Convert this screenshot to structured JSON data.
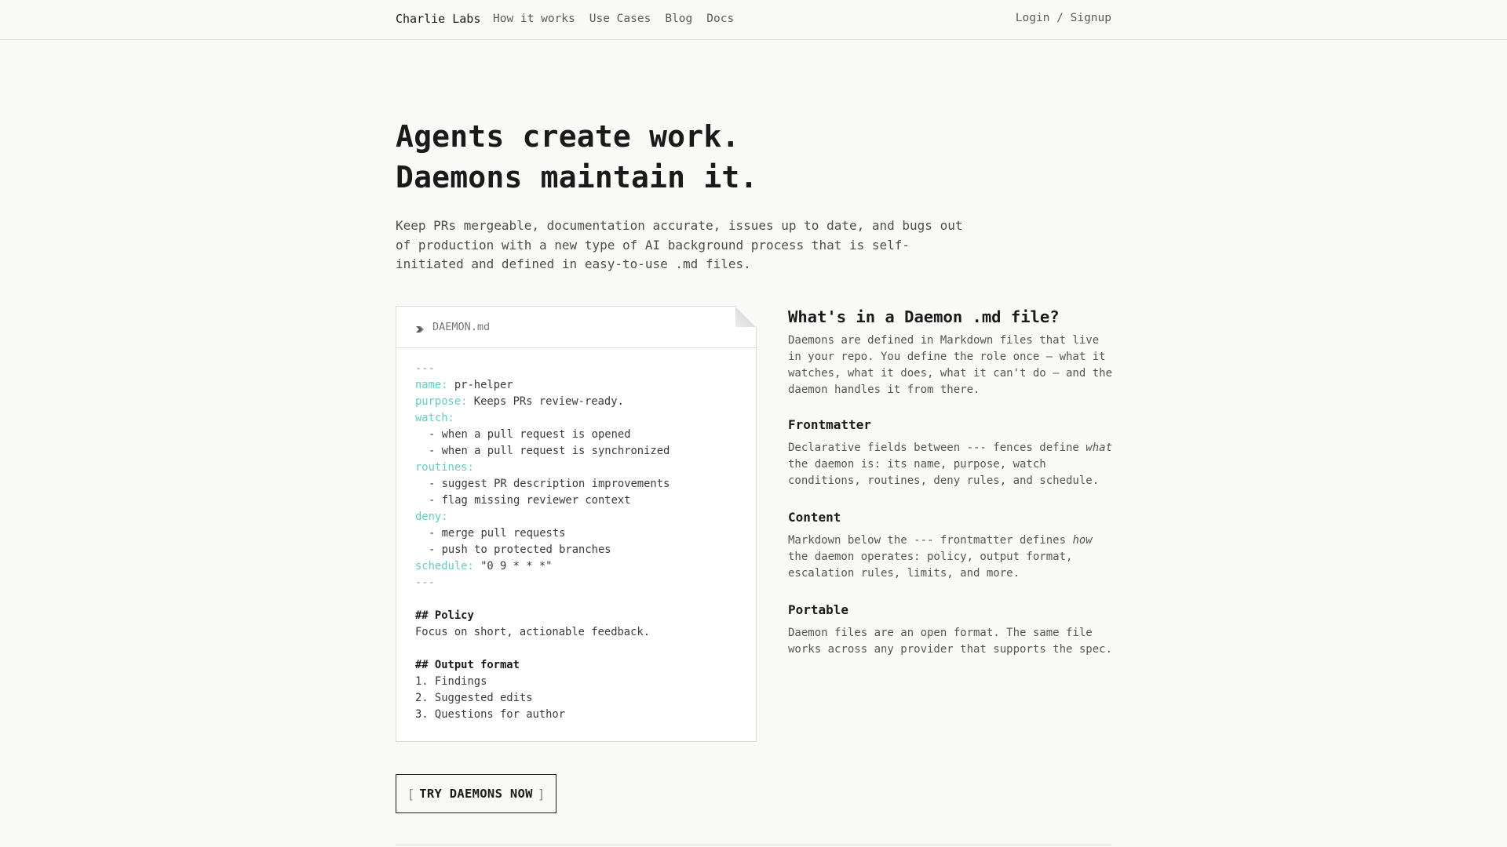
{
  "nav": {
    "brand": "Charlie Labs",
    "links": [
      "How it works",
      "Use Cases",
      "Blog",
      "Docs"
    ],
    "auth": "Login / Signup"
  },
  "hero": {
    "line1": "Agents create work.",
    "line2": "Daemons maintain it.",
    "subtitle": "Keep PRs mergeable, documentation accurate, issues up to date, and bugs out of production with a new type of AI background process that is self-initiated and defined in easy-to-use .md files."
  },
  "file": {
    "icon": "daemon-icon",
    "name": "DAEMON.md",
    "code": {
      "fence": "---",
      "name_key": "name:",
      "name_val": "pr-helper",
      "purpose_key": "purpose:",
      "purpose_val": "Keeps PRs review-ready.",
      "watch_key": "watch:",
      "watch": [
        "- when a pull request is opened",
        "- when a pull request is synchronized"
      ],
      "routines_key": "routines:",
      "routines": [
        "- suggest PR description improvements",
        "- flag missing reviewer context"
      ],
      "deny_key": "deny:",
      "deny": [
        "- merge pull requests",
        "- push to protected branches"
      ],
      "schedule_key": "schedule:",
      "schedule_val": "\"0 9 * * *\"",
      "policy_head": "## Policy",
      "policy_text": "Focus on short, actionable feedback.",
      "output_head": "## Output format",
      "output": [
        "1. Findings",
        "2. Suggested edits",
        "3. Questions for author"
      ]
    }
  },
  "side": {
    "title": "What's in a Daemon .md file?",
    "intro": "Daemons are defined in Markdown files that live in your repo. You define the role once — what it watches, what it does, what it can't do — and the daemon handles it from there.",
    "sections": {
      "frontmatter": {
        "title": "Frontmatter",
        "text_before": "Declarative fields between --- fences define ",
        "emph": "what",
        "text_after": " the daemon is: its name, purpose, watch conditions, routines, deny rules, and schedule."
      },
      "content": {
        "title": "Content",
        "text_before": "Markdown below the --- frontmatter defines ",
        "emph": "how",
        "text_after": " the daemon operates: policy, output format, escalation rules, limits, and more."
      },
      "portable": {
        "title": "Portable",
        "text": "Daemon files are an open format. The same file works across any provider that supports the spec."
      }
    }
  },
  "cta": {
    "open": "[",
    "label": "TRY DAEMONS NOW",
    "close": "]"
  }
}
